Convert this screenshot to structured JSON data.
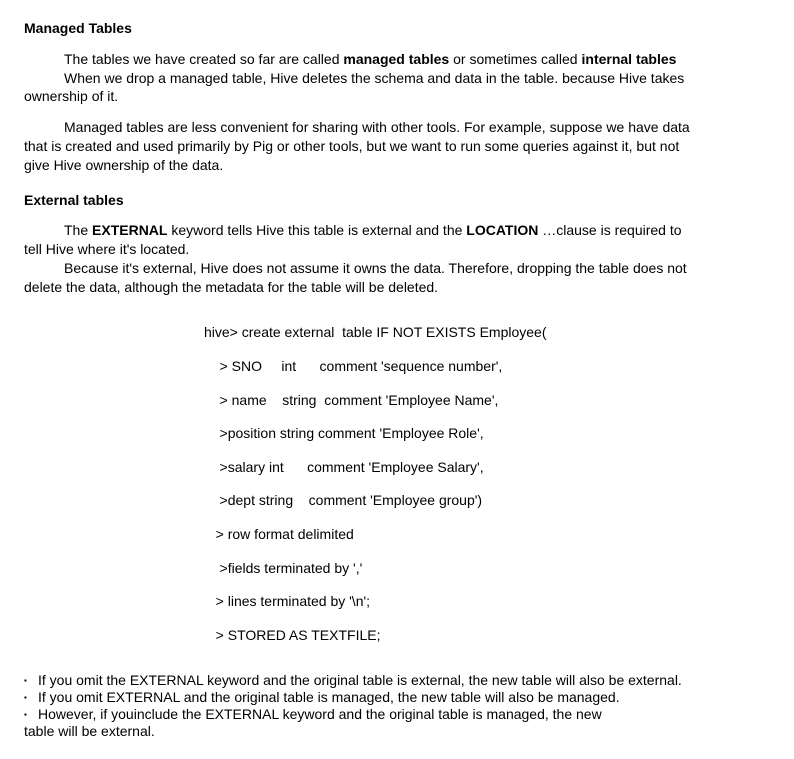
{
  "s1": {
    "title": "Managed Tables",
    "p1a": "The tables we have created so far are called ",
    "p1b": "managed tables",
    "p1c": " or sometimes called ",
    "p1d": "internal tables",
    "p2": "When we drop a managed table, Hive deletes the schema and data in the table. because Hive takes",
    "p2b": "ownership of it.",
    "p3": "Managed tables are less convenient for sharing with other tools. For example, suppose we have data",
    "p3b": "that is created and used primarily by Pig or other tools, but we want to run some queries against it, but not",
    "p3c": "give Hive ownership of the data."
  },
  "s2": {
    "title": "External tables",
    "p1a": "The ",
    "p1b": "EXTERNAL",
    "p1c": " keyword tells Hive this table is external and the ",
    "p1d": "LOCATION",
    "p1e": " …clause is required to",
    "p1f": "tell Hive where it's located.",
    "p2a": "Because it's external, Hive does not assume it owns the data. Therefore, dropping the table does not",
    "p2b": "delete the data, although the metadata for the table will be deleted."
  },
  "code": {
    "l1": "hive> create external  table IF NOT EXISTS Employee(",
    "l2": "    > SNO     int      comment 'sequence number',",
    "l3": "    > name    string  comment 'Employee Name',",
    "l4": "    >position string comment 'Employee Role',",
    "l5": "    >salary int      comment 'Employee Salary',",
    "l6": "    >dept string    comment 'Employee group')",
    "l7": "   > row format delimited",
    "l8": "    >fields terminated by ','",
    "l9": "   > lines terminated by '\\n';",
    "l10": "   > STORED AS TEXTFILE;"
  },
  "bullets": {
    "b1": "If you omit the EXTERNAL keyword and the original table is external, the  new table will also be external.",
    "b2": "If you omit EXTERNAL and the original table is managed, the new table will also be managed.",
    "b3": "However, if youinclude the EXTERNAL keyword and the original table is managed, the new",
    "b3b": "table will be external."
  }
}
